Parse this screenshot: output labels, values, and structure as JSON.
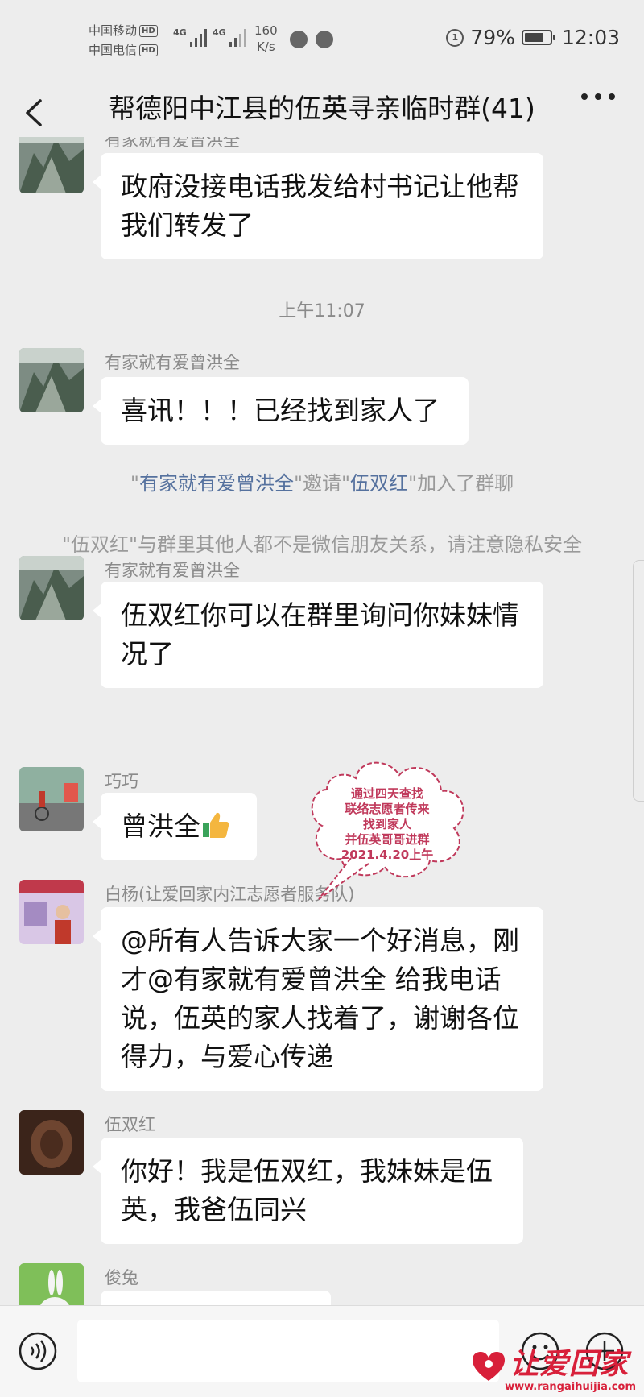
{
  "status_bar": {
    "carrier1": "中国移动",
    "carrier2": "中国电信",
    "hd": "HD",
    "net_type": "4G",
    "net_speed_value": "160",
    "net_speed_unit": "K/s",
    "battery_percent": "79%",
    "battery_level": 0.79,
    "ring_label": "1",
    "time": "12:03"
  },
  "header": {
    "title": "帮德阳中江县的伍英寻亲临时群(41)"
  },
  "messages": [
    {
      "sender": "有家就有爱曾洪全",
      "text": "政府没接电话我发给村书记让他帮我们转发了"
    },
    {
      "timestamp": "上午11:07"
    },
    {
      "sender": "有家就有爱曾洪全",
      "text": "喜讯！！！已经找到家人了"
    },
    {
      "sender": "有家就有爱曾洪全",
      "text": "伍双红你可以在群里询问你妹妹情况了"
    },
    {
      "sender": "巧巧",
      "text": "曾洪全"
    },
    {
      "sender": "白杨(让爱回家内江志愿者服务队)",
      "text": "@所有人告诉大家一个好消息，刚才@有家就有爱曾洪全  给我电话说，伍英的家人找着了，谢谢各位得力，与爱心传递"
    },
    {
      "sender": "伍双红",
      "text": "你好！我是伍双红，我妹妹是伍英，我爸伍同兴"
    },
    {
      "sender": "俊兔",
      "text": ""
    }
  ],
  "system_messages": {
    "invite": {
      "q1": "\"",
      "inviter": "有家就有爱曾洪全",
      "mid": "\"邀请\"",
      "invitee": "伍双红",
      "end": "\"加入了群聊"
    },
    "privacy": "\"伍双红\"与群里其他人都不是微信朋友关系，请注意隐私安全"
  },
  "watermark_cloud": {
    "line1": "通过四天查找",
    "line2": "联络志愿者传来",
    "line3": "找到家人",
    "line4": "并伍英哥哥进群",
    "line5": "2021.4.20上午"
  },
  "brand": {
    "name": "让爱回家",
    "url": "www.rangaihuijia.com"
  },
  "colors": {
    "background": "#ededed",
    "bubble": "#ffffff",
    "system_name": "#55719e",
    "brand_red": "#d8203a"
  }
}
